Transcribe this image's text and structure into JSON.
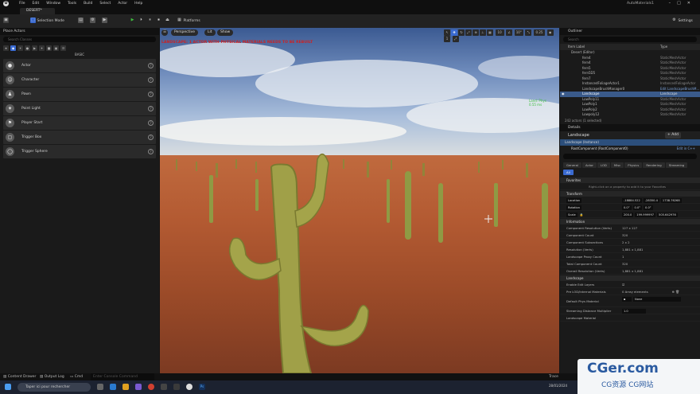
{
  "menubar": {
    "menus": [
      "File",
      "Edit",
      "Window",
      "Tools",
      "Build",
      "Select",
      "Actor",
      "Help"
    ],
    "project": "AutoMaterials1"
  },
  "level_tab": "DESERT*",
  "toolbar": {
    "mode": "Selection Mode",
    "platforms": "Platforms",
    "settings": "Settings"
  },
  "place_actors": {
    "title": "Place Actors",
    "search_placeholder": "Search Classes",
    "section": "BASIC",
    "items": [
      {
        "label": "Actor",
        "icon": "sphere-icon"
      },
      {
        "label": "Character",
        "icon": "character-icon"
      },
      {
        "label": "Pawn",
        "icon": "pawn-icon"
      },
      {
        "label": "Point Light",
        "icon": "light-bulb-icon"
      },
      {
        "label": "Player Start",
        "icon": "flag-icon"
      },
      {
        "label": "Trigger Box",
        "icon": "box-icon"
      },
      {
        "label": "Trigger Sphere",
        "icon": "sphere-icon"
      }
    ]
  },
  "viewport": {
    "perspective": "Perspective",
    "lit": "Lit",
    "show": "Show",
    "warning": "LANDSCAPE: 1 ACTOR WITH PHYSICAL MATERIALS NEEDS TO BE REBUILT",
    "grid_value": "10",
    "rot_value": "10°",
    "scale_value": "0.25",
    "camera_speed": "1",
    "fps_text": "Land: Phys\n0.55 ms"
  },
  "outliner": {
    "title": "Outliner",
    "search_placeholder": "Search",
    "col_label": "Item Label",
    "col_type": "Type",
    "rows": [
      {
        "label": "fern4",
        "type": "StaticMeshActor"
      },
      {
        "label": "fern4",
        "type": "StaticMeshActor"
      },
      {
        "label": "fern5",
        "type": "StaticMeshActor"
      },
      {
        "label": "fern5D5",
        "type": "StaticMeshActor"
      },
      {
        "label": "fern7",
        "type": "StaticMeshActor"
      },
      {
        "label": "InstancedFoliageActor1",
        "type": "InstancedFoliageActor"
      },
      {
        "label": "LandscapeBrushManager0",
        "type": "Edit LandscapeBrushM..."
      },
      {
        "label": "Landscape",
        "type": "Landscape"
      },
      {
        "label": "LowPoly11",
        "type": "StaticMeshActor"
      },
      {
        "label": "LowPoly1",
        "type": "StaticMeshActor"
      },
      {
        "label": "LowPoly2",
        "type": "StaticMeshActor"
      },
      {
        "label": "Lowpoly12",
        "type": "StaticMeshActor"
      }
    ],
    "world": "Desert (Editor)",
    "footer": "242 actors (1 selected)"
  },
  "details": {
    "title": "Details",
    "actor": "Landscape",
    "add": "+ Add",
    "instance": "Landscape (Instance)",
    "root": "RootComponent (RootComponent0)",
    "edit_cpp": "Edit in C++",
    "tabs": [
      "General",
      "Actor",
      "LOD",
      "Misc",
      "Physics",
      "Rendering",
      "Streaming",
      "All"
    ],
    "favorites": "Favorites",
    "fav_hint": "Right-click on a property to add it to your Favorites",
    "transform": "Transform",
    "location": {
      "label": "Location",
      "x": "-18884.522",
      "y": "-28350.4",
      "z": "1738.76268"
    },
    "rotation": {
      "label": "Rotation",
      "x": "0.0°",
      "y": "0.0°",
      "z": "0.0°"
    },
    "scale": {
      "label": "Scale",
      "x": "200.0",
      "y": "199.999997",
      "z": "505.642976"
    },
    "information": "Information",
    "info": [
      {
        "label": "Component Resolution (Verts)",
        "value": "127 x 127"
      },
      {
        "label": "Component Count",
        "value": "320"
      },
      {
        "label": "Component Subsections",
        "value": "2 x 2"
      },
      {
        "label": "Resolution (Verts)",
        "value": "1,881 x 1,881"
      },
      {
        "label": "Landscape Proxy Count",
        "value": "1"
      },
      {
        "label": "Total Component Count",
        "value": "320"
      },
      {
        "label": "Overall Resolution (Verts)",
        "value": "1,881 x 1,881"
      }
    ],
    "landscape": "Landscape",
    "ls": [
      {
        "label": "Enable Edit Layers",
        "value": ""
      },
      {
        "label": "Pre LOD/Internal Materials",
        "value": "0 Array elements"
      },
      {
        "label": "Default Phys Material",
        "value": "None"
      },
      {
        "label": "Streaming Distance Multiplier",
        "value": "1.0"
      },
      {
        "label": "Landscape Material",
        "value": ""
      }
    ]
  },
  "statusbar": {
    "content_drawer": "Content Drawer",
    "output_log": "Output Log",
    "cmd": "Cmd",
    "cmd_placeholder": "Enter Console Command",
    "trace": "Trace"
  },
  "taskbar": {
    "search": "Taper ici pour rechercher",
    "date": "28/01/2024"
  },
  "watermark": {
    "main": "CGer.com",
    "sub": "CG资源 CG网站"
  }
}
